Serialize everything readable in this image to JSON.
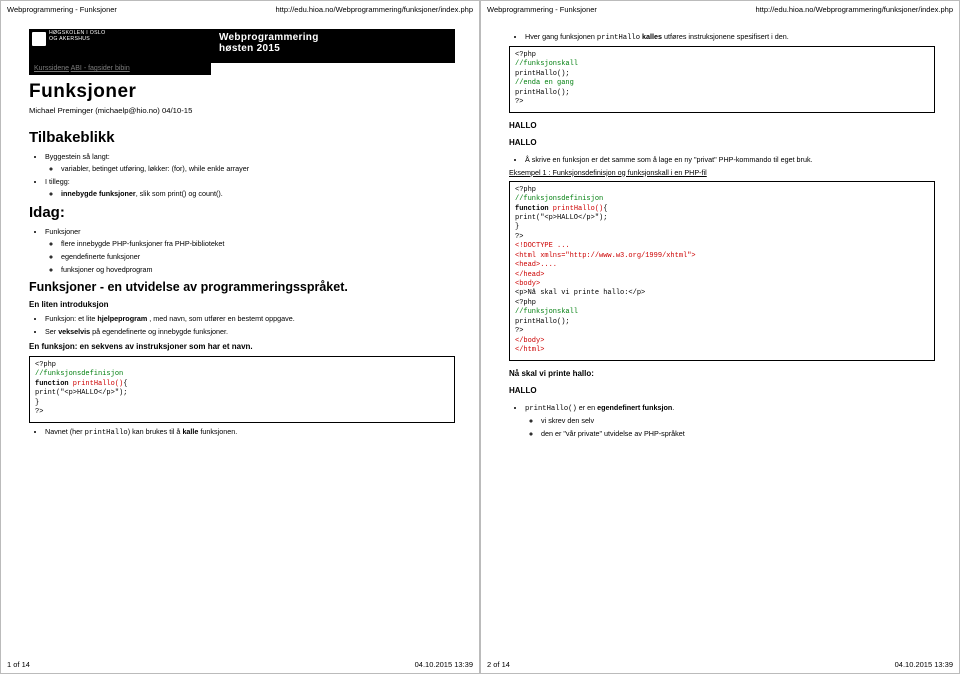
{
  "meta": {
    "header_left": "Webprogrammering - Funksjoner",
    "header_right": "http://edu.hioa.no/Webprogrammering/funksjoner/index.php",
    "p1": "1 of 14",
    "p2": "2 of 14",
    "ts": "04.10.2015 13:39"
  },
  "banner": {
    "logo1": "HØGSKOLEN I OSLO",
    "logo2": "OG AKERSHUS",
    "title1": "Webprogrammering",
    "title2": "høsten 2015",
    "series_a": "Kurssidene",
    "series_sep": "   ",
    "series_b": "ABI - fagsider bibin",
    "h1": "Funksjoner",
    "author": "Michael Preminger (michaelp@hio.no) 04/10-15"
  },
  "left": {
    "tilbake": "Tilbakeblikk",
    "byg": "Byggestein så langt:",
    "byg_i": "variabler, betinget utføring, løkker: (for), while enkle arrayer",
    "til": "I tillegg:",
    "til_i": "innebygde funksjoner",
    "til_i_tail": ", slik som print() og count().",
    "idag": "Idag:",
    "funks": "Funksjoner",
    "idag_a": "flere innebygde PHP-funksjoner fra PHP-biblioteket",
    "idag_b": "egendefinerte funksjoner",
    "idag_c": "funksjoner og hovedprogram",
    "h2b": "Funksjoner - en utvidelse av programmeringsspråket.",
    "intro": "En liten introduksjon",
    "li_intro_a1": "Funksjon: et lite ",
    "li_intro_a2": "hjelpeprogram",
    "li_intro_a3": " , med navn, som utfører en bestemt oppgave.",
    "li_intro_b1": "Ser ",
    "li_intro_b2": "vekselvis",
    "li_intro_b3": " på egendefinerte og innebygde funksjoner.",
    "seq": "En funksjon: en sekvens av instruksjoner som har et navn.",
    "code1_l1": "<?php",
    "code1_l2": "//funksjonsdefinisjon",
    "code1_l3a": "function",
    "code1_l3b": " printHallo()",
    "code1_l3c": "{",
    "code1_l4": "    print(\"<p>HALLO</p>\");",
    "code1_l5": "}",
    "code1_l6": "?>",
    "after1a": "Navnet (her ",
    "after1b": "printHallo",
    "after1c": ") kan brukes til å ",
    "after1d": "kalle",
    "after1e": " funksjonen."
  },
  "right": {
    "top_li_a": "Hver gang funksjonen ",
    "top_li_b": "printHallo",
    "top_li_c": " kalles",
    "top_li_d": " utføres instruksjonene spesifisert i den.",
    "code2_l1": "<?php",
    "code2_l2": "//funksjonskall",
    "code2_l3": "  printHallo();",
    "code2_l4": "//enda en gang",
    "code2_l5": "  printHallo();",
    "code2_l6": "?>",
    "out1": "HALLO",
    "out2": "HALLO",
    "li_skrive": "Å skrive en funksjon er det samme som å lage en ny \"privat\" PHP-kommando til eget bruk.",
    "eks": "Eksempel 1 : Funksjonsdefinisjon og funksjonskall i en PHP-fil",
    "c3_l1": "<?php",
    "c3_l2": "//funksjonsdefinisjon",
    "c3_l3a": "function",
    "c3_l3b": " printHallo()",
    "c3_l3c": "{",
    "c3_l4": "    print(\"<p>HALLO</p>\");",
    "c3_l5": "}",
    "c3_l6": "?>",
    "c3_l7": "<!DOCTYPE ...",
    "c3_l8": "<html xmlns=\"http://www.w3.org/1999/xhtml\">",
    "c3_l9": "<head>....",
    "c3_l10": "</head>",
    "c3_l11": "<body>",
    "c3_l12": "<p>Nå skal vi printe hallo:</p>",
    "c3_l13": "<?php",
    "c3_l14": "//funksjonskall",
    "c3_l15": "  printHallo();",
    "c3_l16": "?>",
    "c3_l17": "</body>",
    "c3_l18": "</html>",
    "out3": "Nå skal vi printe hallo:",
    "out4": "HALLO",
    "li_eg": "printHallo()",
    "li_eg_tail": " er en ",
    "li_eg_tail2": "egendefinert funksjon",
    "sub_a": "vi skrev den selv",
    "sub_b": "den er \"vår private\" utvidelse av PHP-språket"
  }
}
